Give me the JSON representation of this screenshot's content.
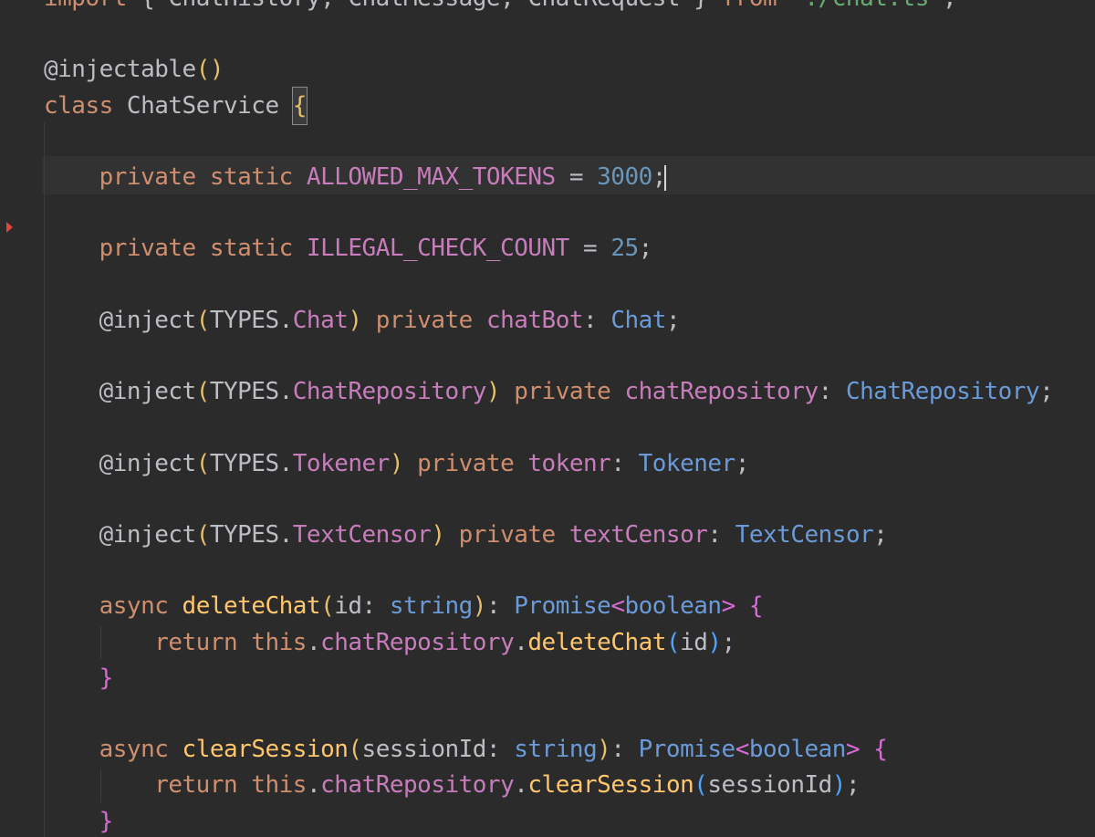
{
  "editor": {
    "language": "TypeScript",
    "theme_colors": {
      "background": "#2b2b2b",
      "keyword": "#cf8e6d",
      "field": "#c77dbb",
      "number": "#6897bb",
      "type": "#6a9bd8",
      "function": "#ffc66d",
      "decorator": "#bbb529",
      "text": "#bcbec4"
    },
    "gutter": {
      "marker_icon": "breakpoint-arrow-icon"
    },
    "lines": [
      {
        "tokens": [
          {
            "t": "import ",
            "c": "kw"
          },
          {
            "t": "{ ChatHistory, ChatMessage, ChatRequest } ",
            "c": "default"
          },
          {
            "t": "from ",
            "c": "kw"
          },
          {
            "t": "'./chat.ts'",
            "c": "str"
          },
          {
            "t": ";",
            "c": "default"
          }
        ]
      },
      {
        "tokens": []
      },
      {
        "tokens": [
          {
            "t": "@injectable",
            "c": "default"
          },
          {
            "t": "()",
            "c": "bracket-y"
          }
        ]
      },
      {
        "tokens": [
          {
            "t": "class ",
            "c": "kw"
          },
          {
            "t": "ChatService ",
            "c": "default"
          },
          {
            "t": "{",
            "c": "bracket-y",
            "brace": true
          }
        ]
      },
      {
        "tokens": []
      },
      {
        "tokens": [
          {
            "t": "    private static ",
            "c": "kw"
          },
          {
            "t": "ALLOWED_MAX_TOKENS",
            "c": "field"
          },
          {
            "t": " = ",
            "c": "default"
          },
          {
            "t": "3000",
            "c": "num"
          },
          {
            "t": ";",
            "c": "default",
            "caret": true
          }
        ]
      },
      {
        "tokens": []
      },
      {
        "tokens": [
          {
            "t": "    private static ",
            "c": "kw"
          },
          {
            "t": "ILLEGAL_CHECK_COUNT",
            "c": "field"
          },
          {
            "t": " = ",
            "c": "default"
          },
          {
            "t": "25",
            "c": "num"
          },
          {
            "t": ";",
            "c": "default"
          }
        ]
      },
      {
        "tokens": []
      },
      {
        "tokens": [
          {
            "t": "    @inject",
            "c": "default"
          },
          {
            "t": "(",
            "c": "bracket-y"
          },
          {
            "t": "TYPES.",
            "c": "default"
          },
          {
            "t": "Chat",
            "c": "field"
          },
          {
            "t": ") ",
            "c": "bracket-y"
          },
          {
            "t": "private ",
            "c": "kw"
          },
          {
            "t": "chatBot",
            "c": "field"
          },
          {
            "t": ": ",
            "c": "default"
          },
          {
            "t": "Chat",
            "c": "type"
          },
          {
            "t": ";",
            "c": "default"
          }
        ]
      },
      {
        "tokens": []
      },
      {
        "tokens": [
          {
            "t": "    @inject",
            "c": "default"
          },
          {
            "t": "(",
            "c": "bracket-y"
          },
          {
            "t": "TYPES.",
            "c": "default"
          },
          {
            "t": "ChatRepository",
            "c": "field"
          },
          {
            "t": ") ",
            "c": "bracket-y"
          },
          {
            "t": "private ",
            "c": "kw"
          },
          {
            "t": "chatRepository",
            "c": "field"
          },
          {
            "t": ": ",
            "c": "default"
          },
          {
            "t": "ChatRepository",
            "c": "type"
          },
          {
            "t": ";",
            "c": "default"
          }
        ]
      },
      {
        "tokens": []
      },
      {
        "tokens": [
          {
            "t": "    @inject",
            "c": "default"
          },
          {
            "t": "(",
            "c": "bracket-y"
          },
          {
            "t": "TYPES.",
            "c": "default"
          },
          {
            "t": "Tokener",
            "c": "field"
          },
          {
            "t": ") ",
            "c": "bracket-y"
          },
          {
            "t": "private ",
            "c": "kw"
          },
          {
            "t": "tokenr",
            "c": "field"
          },
          {
            "t": ": ",
            "c": "default"
          },
          {
            "t": "Tokener",
            "c": "type"
          },
          {
            "t": ";",
            "c": "default"
          }
        ]
      },
      {
        "tokens": []
      },
      {
        "tokens": [
          {
            "t": "    @inject",
            "c": "default"
          },
          {
            "t": "(",
            "c": "bracket-y"
          },
          {
            "t": "TYPES.",
            "c": "default"
          },
          {
            "t": "TextCensor",
            "c": "field"
          },
          {
            "t": ") ",
            "c": "bracket-y"
          },
          {
            "t": "private ",
            "c": "kw"
          },
          {
            "t": "textCensor",
            "c": "field"
          },
          {
            "t": ": ",
            "c": "default"
          },
          {
            "t": "TextCensor",
            "c": "type"
          },
          {
            "t": ";",
            "c": "default"
          }
        ]
      },
      {
        "tokens": []
      },
      {
        "tokens": [
          {
            "t": "    async ",
            "c": "kw"
          },
          {
            "t": "deleteChat",
            "c": "fn"
          },
          {
            "t": "(",
            "c": "bracket-y"
          },
          {
            "t": "id: ",
            "c": "default"
          },
          {
            "t": "string",
            "c": "type"
          },
          {
            "t": ")",
            "c": "bracket-y"
          },
          {
            "t": ": ",
            "c": "default"
          },
          {
            "t": "Promise",
            "c": "type"
          },
          {
            "t": "<",
            "c": "bracket-p"
          },
          {
            "t": "boolean",
            "c": "type"
          },
          {
            "t": "> ",
            "c": "bracket-p"
          },
          {
            "t": "{",
            "c": "bracket-p"
          }
        ]
      },
      {
        "tokens": [
          {
            "t": "        return ",
            "c": "kw"
          },
          {
            "t": "this",
            "c": "kw"
          },
          {
            "t": ".",
            "c": "default"
          },
          {
            "t": "chatRepository",
            "c": "field"
          },
          {
            "t": ".",
            "c": "default"
          },
          {
            "t": "deleteChat",
            "c": "fn"
          },
          {
            "t": "(",
            "c": "bracket-b"
          },
          {
            "t": "id",
            "c": "default"
          },
          {
            "t": ")",
            "c": "bracket-b"
          },
          {
            "t": ";",
            "c": "default"
          }
        ]
      },
      {
        "tokens": [
          {
            "t": "    }",
            "c": "bracket-p"
          }
        ]
      },
      {
        "tokens": []
      },
      {
        "tokens": [
          {
            "t": "    async ",
            "c": "kw"
          },
          {
            "t": "clearSession",
            "c": "fn"
          },
          {
            "t": "(",
            "c": "bracket-y"
          },
          {
            "t": "sessionId: ",
            "c": "default"
          },
          {
            "t": "string",
            "c": "type"
          },
          {
            "t": ")",
            "c": "bracket-y"
          },
          {
            "t": ": ",
            "c": "default"
          },
          {
            "t": "Promise",
            "c": "type"
          },
          {
            "t": "<",
            "c": "bracket-p"
          },
          {
            "t": "boolean",
            "c": "type"
          },
          {
            "t": "> ",
            "c": "bracket-p"
          },
          {
            "t": "{",
            "c": "bracket-p"
          }
        ]
      },
      {
        "tokens": [
          {
            "t": "        return ",
            "c": "kw"
          },
          {
            "t": "this",
            "c": "kw"
          },
          {
            "t": ".",
            "c": "default"
          },
          {
            "t": "chatRepository",
            "c": "field"
          },
          {
            "t": ".",
            "c": "default"
          },
          {
            "t": "clearSession",
            "c": "fn"
          },
          {
            "t": "(",
            "c": "bracket-b"
          },
          {
            "t": "sessionId",
            "c": "default"
          },
          {
            "t": ")",
            "c": "bracket-b"
          },
          {
            "t": ";",
            "c": "default"
          }
        ]
      },
      {
        "tokens": [
          {
            "t": "    }",
            "c": "bracket-p"
          }
        ]
      }
    ]
  }
}
